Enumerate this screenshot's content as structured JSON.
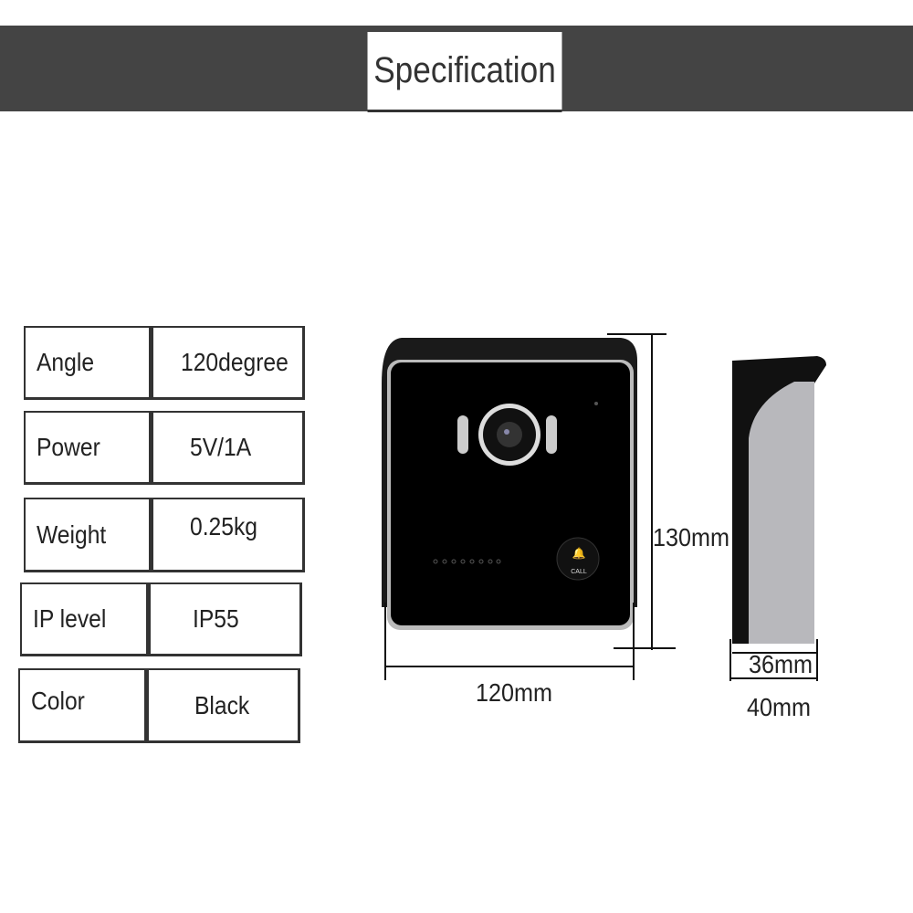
{
  "header": {
    "title": "Specification"
  },
  "specs": [
    {
      "label": "Angle",
      "value": "120degree"
    },
    {
      "label": "Power",
      "value": "5V/1A"
    },
    {
      "label": "Weight",
      "value": "0.25kg"
    },
    {
      "label": "IP level",
      "value": "IP55"
    },
    {
      "label": "Color",
      "value": "Black"
    }
  ],
  "device": {
    "call_label": "CALL"
  },
  "dimensions": {
    "width": "120mm",
    "height": "130mm",
    "depth_inner": "36mm",
    "depth_outer": "40mm"
  }
}
